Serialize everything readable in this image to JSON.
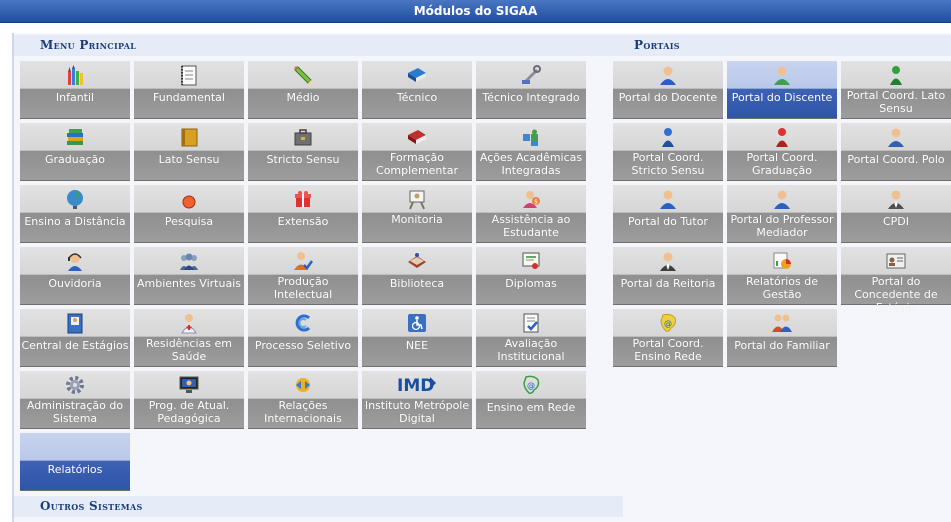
{
  "title": "Módulos do SIGAA",
  "menu_principal": {
    "heading": "Menu Principal",
    "tiles": [
      {
        "label": "Infantil",
        "icon": "crayons-icon"
      },
      {
        "label": "Fundamental",
        "icon": "notebook-icon"
      },
      {
        "label": "Médio",
        "icon": "pencil-icon"
      },
      {
        "label": "Técnico",
        "icon": "book-icon"
      },
      {
        "label": "Técnico Integrado",
        "icon": "tools-icon"
      },
      {
        "label": "Graduação",
        "icon": "books-stack-icon"
      },
      {
        "label": "Lato Sensu",
        "icon": "folder-icon"
      },
      {
        "label": "Stricto Sensu",
        "icon": "briefcase-icon"
      },
      {
        "label": "Formação Complementar",
        "icon": "red-book-icon"
      },
      {
        "label": "Ações Acadêmicas Integradas",
        "icon": "puzzle-icon"
      },
      {
        "label": "Ensino a Distância",
        "icon": "globe-icon"
      },
      {
        "label": "Pesquisa",
        "icon": "flask-icon"
      },
      {
        "label": "Extensão",
        "icon": "gift-icon"
      },
      {
        "label": "Monitoria",
        "icon": "easel-icon"
      },
      {
        "label": "Assistência ao Estudante",
        "icon": "support-person-icon"
      },
      {
        "label": "Ouvidoria",
        "icon": "headset-icon"
      },
      {
        "label": "Ambientes Virtuais",
        "icon": "group-icon"
      },
      {
        "label": "Produção Intelectual",
        "icon": "person-check-icon"
      },
      {
        "label": "Biblioteca",
        "icon": "open-book-icon"
      },
      {
        "label": "Diplomas",
        "icon": "certificate-icon"
      },
      {
        "label": "Central de Estágios",
        "icon": "binder-icon"
      },
      {
        "label": "Residências em Saúde",
        "icon": "doctor-icon"
      },
      {
        "label": "Processo Seletivo",
        "icon": "swirl-icon"
      },
      {
        "label": "NEE",
        "icon": "wheelchair-icon"
      },
      {
        "label": "Avaliação Institucional",
        "icon": "checklist-icon"
      },
      {
        "label": "Administração do Sistema",
        "icon": "gear-icon"
      },
      {
        "label": "Prog. de Atual. Pedagógica",
        "icon": "monitor-icon"
      },
      {
        "label": "Relações Internacionais",
        "icon": "globe-arrows-icon"
      },
      {
        "label": "Instituto Metrópole Digital",
        "icon": "imd-logo-icon"
      },
      {
        "label": "Ensino em Rede",
        "icon": "brazil-map-icon"
      },
      {
        "label": "Relatórios",
        "icon": "none"
      }
    ]
  },
  "portais": {
    "heading": "Portais",
    "tiles": [
      {
        "label": "Portal do Docente",
        "icon": "teacher-icon"
      },
      {
        "label": "Portal do Discente",
        "icon": "student-icon"
      },
      {
        "label": "Portal Coord. Lato Sensu",
        "icon": "green-user-icon"
      },
      {
        "label": "Portal Coord. Stricto Sensu",
        "icon": "blue-user-icon"
      },
      {
        "label": "Portal Coord. Graduação",
        "icon": "red-user-icon"
      },
      {
        "label": "Portal Coord. Polo",
        "icon": "user-icon"
      },
      {
        "label": "Portal do Tutor",
        "icon": "tutor-icon"
      },
      {
        "label": "Portal do Professor Mediador",
        "icon": "mediator-icon"
      },
      {
        "label": "CPDI",
        "icon": "user-tie-icon"
      },
      {
        "label": "Portal da Reitoria",
        "icon": "rector-icon"
      },
      {
        "label": "Relatórios de Gestão",
        "icon": "charts-icon"
      },
      {
        "label": "Portal do Concedente de Estágio",
        "icon": "id-card-icon"
      },
      {
        "label": "Portal Coord. Ensino Rede",
        "icon": "brazil-map-icon"
      },
      {
        "label": "Portal do Familiar",
        "icon": "family-icon"
      }
    ]
  },
  "outros": {
    "heading": "Outros Sistemas"
  },
  "colors": {
    "title_bar": "#1e4fa0",
    "tile_gray": "#9d9d9d",
    "tile_selected": "#2f55a9",
    "section_heading": "#1b3c7a"
  }
}
